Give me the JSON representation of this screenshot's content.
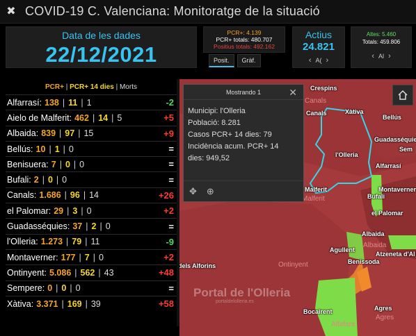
{
  "app": {
    "title": "COVID-19 C. Valenciana: Monitoratge de la situació",
    "logo_icon": "virus-icon"
  },
  "date_panel": {
    "label": "Data de les dades",
    "value": "22/12/2021"
  },
  "pcr_box": {
    "line1": "PCR+: 4.139",
    "line2": "PCR+ totals: 480.707",
    "line3": "Positius totals: 492.162"
  },
  "tabs": [
    "Posit.",
    "Gràf."
  ],
  "actius": {
    "label": "Actius",
    "value": "24.821",
    "pager_label": "A("
  },
  "altes": {
    "line1": "Altes: 5.460",
    "line2": "Totals: 459.806",
    "pager_label": "Al"
  },
  "legend": {
    "pcr": "PCR+",
    "sep": "|",
    "d14": "PCR+ 14 dies",
    "mort": "Morts"
  },
  "municipalities": [
    {
      "name": "Alfarrasí:",
      "pcr": "138",
      "d14": "11",
      "mort": "1",
      "delta": "-2",
      "kind": "neg"
    },
    {
      "name": "Aielo de Malferit:",
      "pcr": "462",
      "d14": "14",
      "mort": "5",
      "delta": "+5",
      "kind": "pos"
    },
    {
      "name": "Albaida:",
      "pcr": "839",
      "d14": "97",
      "mort": "15",
      "delta": "+9",
      "kind": "pos"
    },
    {
      "name": "Bellús:",
      "pcr": "10",
      "d14": "1",
      "mort": "0",
      "delta": "=",
      "kind": "eq"
    },
    {
      "name": "Benisuera:",
      "pcr": "7",
      "d14": "0",
      "mort": "0",
      "delta": "=",
      "kind": "eq"
    },
    {
      "name": "Bufali:",
      "pcr": "2",
      "d14": "0",
      "mort": "0",
      "delta": "=",
      "kind": "eq"
    },
    {
      "name": "Canals:",
      "pcr": "1.686",
      "d14": "96",
      "mort": "14",
      "delta": "+26",
      "kind": "pos"
    },
    {
      "name": "el Palomar:",
      "pcr": "29",
      "d14": "3",
      "mort": "0",
      "delta": "+2",
      "kind": "pos"
    },
    {
      "name": "Guadasséquies:",
      "pcr": "37",
      "d14": "2",
      "mort": "0",
      "delta": "=",
      "kind": "eq"
    },
    {
      "name": "l'Olleria:",
      "pcr": "1.273",
      "d14": "79",
      "mort": "11",
      "delta": "-9",
      "kind": "neg"
    },
    {
      "name": "Montaverner:",
      "pcr": "177",
      "d14": "7",
      "mort": "0",
      "delta": "+2",
      "kind": "pos"
    },
    {
      "name": "Ontinyent:",
      "pcr": "5.086",
      "d14": "562",
      "mort": "43",
      "delta": "+48",
      "kind": "pos"
    },
    {
      "name": "Sempere:",
      "pcr": "0",
      "d14": "0",
      "mort": "0",
      "delta": "=",
      "kind": "eq"
    },
    {
      "name": "Xàtiva:",
      "pcr": "3.371",
      "d14": "169",
      "mort": "39",
      "delta": "+58",
      "kind": "pos"
    }
  ],
  "popup": {
    "header": "Mostrando 1",
    "lines": [
      "Municipi: l'Olleria",
      "Població: 8.281",
      "Casos PCR+ 14 dies: 79",
      "Incidència acum. PCR+ 14",
      "dies: 949,52"
    ]
  },
  "map": {
    "labels": [
      "Crespins",
      "Canals",
      "Xàtiva",
      "Bellús",
      "Guadasséquies",
      "Sem",
      "l'Olleria",
      "Alfarrasí",
      "Malferit",
      "Montaverner",
      "Bufali",
      "el Palomar",
      "Albaida",
      "Agullent",
      "Atzeneta d'Al",
      "Benissoda",
      "dels Alforins",
      "Ontinyent",
      "Agres",
      "Bocairent",
      "Alfafara"
    ],
    "dim_labels": [
      "Canals",
      "Malferit",
      "Albaida",
      "Agres"
    ],
    "watermark": "Portal de l'Olleria",
    "watermark_sub": "portaldelolleria.es",
    "colors": {
      "base": "#a43a3c",
      "dark": "#8d2f31",
      "green": "#7ddc47",
      "orange": "#f08a2c",
      "boundary": "#37d6e6"
    }
  }
}
